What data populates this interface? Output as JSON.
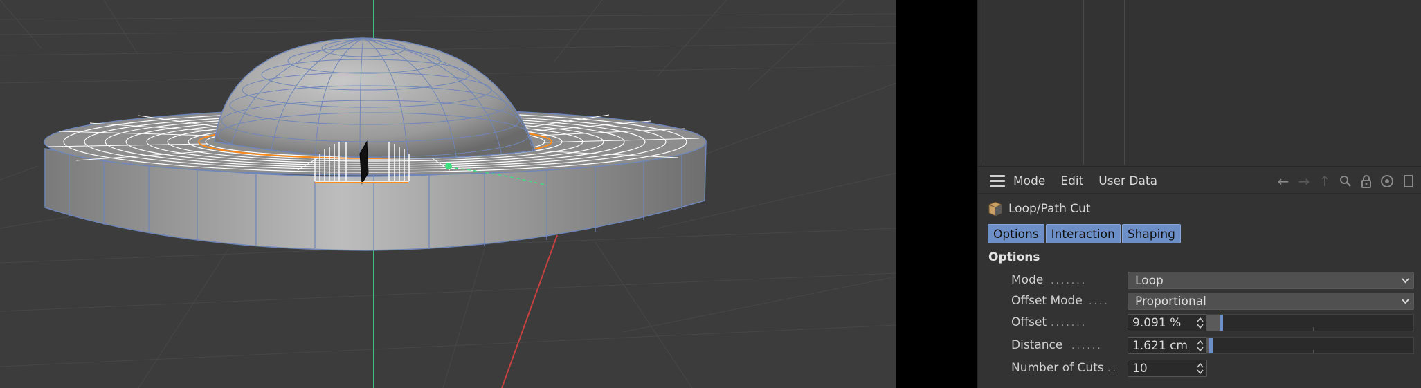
{
  "attribute_manager": {
    "menu": [
      "Mode",
      "Edit",
      "User Data"
    ],
    "tool_title": "Loop/Path Cut",
    "tabs": [
      "Options",
      "Interaction",
      "Shaping"
    ],
    "section_title": "Options",
    "params": {
      "mode": {
        "label": "Mode",
        "value": "Loop"
      },
      "offset_mode": {
        "label": "Offset Mode",
        "value": "Proportional"
      },
      "offset": {
        "label": "Offset",
        "value": "9.091 %",
        "slider_fraction": 0.06
      },
      "distance": {
        "label": "Distance",
        "value": "1.621 cm",
        "slider_fraction": 0.01
      },
      "number_of_cuts": {
        "label": "Number of Cuts",
        "value": "10"
      }
    }
  },
  "icons": {
    "menu": "hamburger-icon",
    "nav": [
      "back-arrow-icon",
      "forward-arrow-icon",
      "up-arrow-icon",
      "search-icon",
      "lock-icon",
      "target-icon",
      "new-window-icon"
    ],
    "tool": "cube-icon"
  },
  "colors": {
    "viewport_bg": "#3c3c3c",
    "panel_bg": "#333333",
    "tab_active": "#6d8fc7",
    "wireframe": "#6f86b8",
    "cut_loop": "#ff8c1a",
    "y_axis": "#3fbf7f",
    "x_axis": "#c94040"
  }
}
